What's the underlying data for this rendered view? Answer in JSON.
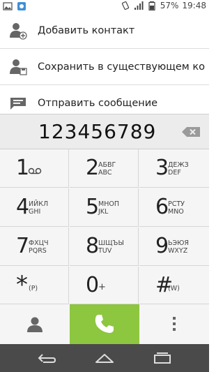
{
  "status_bar": {
    "battery": "57%",
    "time": "19:48",
    "left_icons": [
      "image-icon",
      "app-notification-icon"
    ],
    "right_icons": [
      "vibrate-icon",
      "signal-icon",
      "battery-icon"
    ]
  },
  "actions": [
    {
      "label": "Добавить контакт",
      "icon": "add-contact-icon"
    },
    {
      "label": "Сохранить в существующем кон…",
      "icon": "save-to-contact-icon"
    },
    {
      "label": "Отправить сообщение",
      "icon": "message-icon"
    }
  ],
  "dialer": {
    "number": "123456789",
    "delete_icon": "backspace-icon"
  },
  "keys": [
    {
      "digit": "1",
      "sub": "",
      "icon": "voicemail-icon"
    },
    {
      "digit": "2",
      "sub": "АБВГ\nABC"
    },
    {
      "digit": "3",
      "sub": "ДЕЖЗ\nDEF"
    },
    {
      "digit": "4",
      "sub": "ИЙКЛ\nGHI"
    },
    {
      "digit": "5",
      "sub": "МНОП\nJKL"
    },
    {
      "digit": "6",
      "sub": "РСТУ\nMNO"
    },
    {
      "digit": "7",
      "sub": "ФХЦЧ\nPQRS"
    },
    {
      "digit": "8",
      "sub": "ШЩЪЫ\nTUV"
    },
    {
      "digit": "9",
      "sub": "ЬЭЮЯ\nWXYZ"
    },
    {
      "digit": "*",
      "sub": "(P)"
    },
    {
      "digit": "0",
      "sub": "+"
    },
    {
      "digit": "#",
      "sub": "(W)"
    }
  ],
  "bottom_row": {
    "contacts_icon": "person-icon",
    "call_icon": "phone-icon",
    "menu_icon": "overflow-menu-icon",
    "call_color": "#8dc63f"
  },
  "nav_bar": {
    "back_icon": "back-icon",
    "home_icon": "home-icon",
    "recents_icon": "recents-icon"
  }
}
